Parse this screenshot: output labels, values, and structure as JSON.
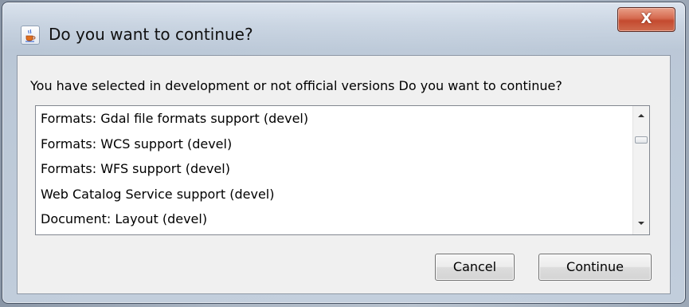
{
  "window": {
    "title": "Do you want to continue?",
    "close_label": "X",
    "app_icon": "java-cup-icon"
  },
  "dialog": {
    "message": "You have selected in development or not official versions Do you want to continue?",
    "items": [
      "Formats: Gdal file formats support (devel)",
      "Formats: WCS support (devel)",
      "Formats: WFS support (devel)",
      "Web Catalog Service support (devel)",
      "Document: Layout (devel)"
    ]
  },
  "buttons": {
    "cancel_label": "Cancel",
    "continue_label": "Continue"
  },
  "colors": {
    "close_button": "#c9553a",
    "dialog_background": "#f0f0f0",
    "list_background": "#ffffff"
  }
}
